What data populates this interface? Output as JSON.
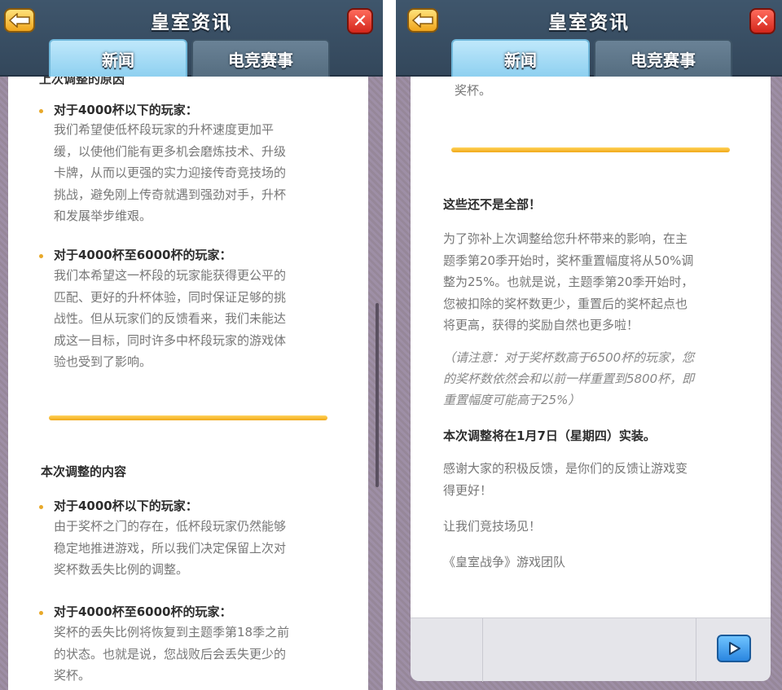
{
  "header": {
    "title": "皇室资讯",
    "tabs": [
      {
        "label": "新闻",
        "active": true
      },
      {
        "label": "电竞赛事",
        "active": false
      }
    ]
  },
  "left": {
    "cut_heading": "上次调整的原因",
    "bullets1": [
      {
        "heading": "对于4000杯以下的玩家：",
        "lines": [
          "我们希望使低杯段玩家的升杯速度更加平",
          "缓，以使他们能有更多机会磨炼技术、升级",
          "卡牌，从而以更强的实力迎接传奇竞技场的",
          "挑战，避免刚上传奇就遇到强劲对手，升杯",
          "和发展举步维艰。"
        ]
      },
      {
        "heading": "对于4000杯至6000杯的玩家：",
        "lines": [
          "我们本希望这一杯段的玩家能获得更公平的",
          "匹配、更好的升杯体验，同时保证足够的挑",
          "战性。但从玩家们的反馈看来，我们未能达",
          "成这一目标，同时许多中杯段玩家的游戏体",
          "验也受到了影响。"
        ]
      }
    ],
    "section2": "本次调整的内容",
    "bullets2": [
      {
        "heading": "对于4000杯以下的玩家：",
        "lines": [
          "由于奖杯之门的存在，低杯段玩家仍然能够",
          "稳定地推进游戏，所以我们决定保留上次对",
          "奖杯数丢失比例的调整。"
        ]
      },
      {
        "heading": "对于4000杯至6000杯的玩家：",
        "lines": [
          "奖杯的丢失比例将恢复到主题季第18季之前",
          "的状态。也就是说，您战败后会丢失更少的",
          "奖杯。"
        ]
      }
    ]
  },
  "right": {
    "cut_line": "奖杯。",
    "heading": "这些还不是全部！",
    "para1": [
      "为了弥补上次调整给您升杯带来的影响，在主",
      "题季第20季开始时，奖杯重置幅度将从50%调",
      "整为25%。也就是说，主题季第20季开始时，",
      "您被扣除的奖杯数更少，重置后的奖杯起点也",
      "将更高，获得的奖励自然也更多啦！"
    ],
    "note": [
      "（请注意：对于奖杯数高于6500杯的玩家，您",
      "的奖杯数依然会和以前一样重置到5800杯，即",
      "重置幅度可能高于25%）"
    ],
    "release": "本次调整将在1月7日（星期四）实装。",
    "thanks": [
      "感谢大家的积极反馈，是你们的反馈让游戏变",
      "得更好！"
    ],
    "see_you": "让我们竞技场见！",
    "signature": "《皇室战争》游戏团队"
  },
  "colors": {
    "accent_gold": "#f0a818",
    "tab_active": "#8ed0f0",
    "header_bg": "#3f566c"
  }
}
